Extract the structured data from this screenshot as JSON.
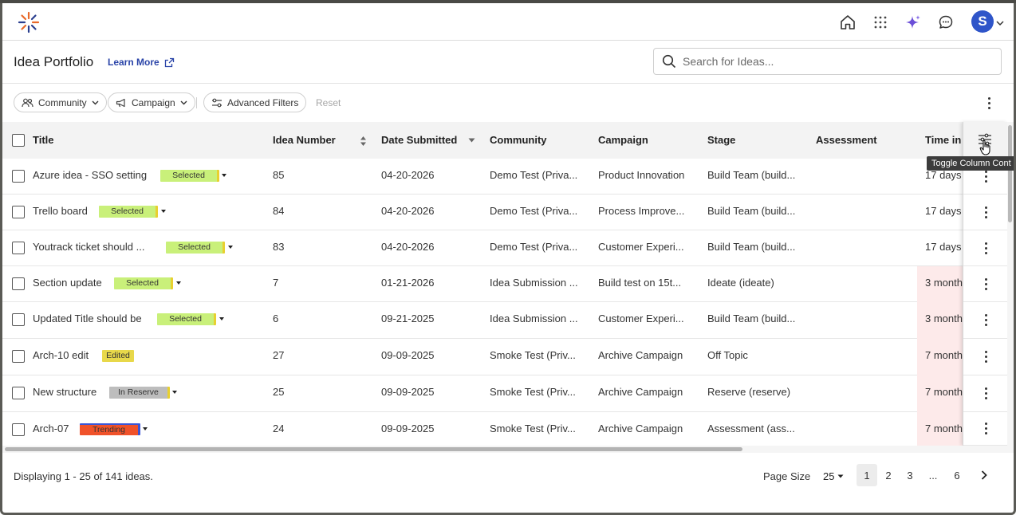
{
  "header": {
    "icons": [
      "home-icon",
      "apps-grid-icon",
      "ai-sparkle-icon",
      "chat-icon"
    ],
    "avatar_initial": "S"
  },
  "titlebar": {
    "title": "Idea Portfolio",
    "learn_more": "Learn More",
    "search_placeholder": "Search for Ideas..."
  },
  "filters": {
    "community": "Community",
    "campaign": "Campaign",
    "advanced": "Advanced Filters",
    "reset": "Reset"
  },
  "columns": {
    "title": "Title",
    "idea_number": "Idea Number",
    "date_submitted": "Date Submitted",
    "community": "Community",
    "campaign": "Campaign",
    "stage": "Stage",
    "assessment": "Assessment",
    "time_in": "Time in"
  },
  "tooltip": "Toggle Column Cont",
  "rows": [
    {
      "title": "Azure idea - SSO setting",
      "status": "Selected",
      "number": "85",
      "date": "04-20-2026",
      "community": "Demo Test (Priva...",
      "campaign": "Product Innovation",
      "stage": "Build Team (build...",
      "assessment": "",
      "time": "17 days"
    },
    {
      "title": "Trello board",
      "status": "Selected",
      "number": "84",
      "date": "04-20-2026",
      "community": "Demo Test (Priva...",
      "campaign": "Process Improve...",
      "stage": "Build Team (build...",
      "assessment": "",
      "time": "17 days"
    },
    {
      "title": "Youtrack ticket should ...",
      "status": "Selected",
      "number": "83",
      "date": "04-20-2026",
      "community": "Demo Test (Priva...",
      "campaign": "Customer Experi...",
      "stage": "Build Team (build...",
      "assessment": "",
      "time": "17 days"
    },
    {
      "title": "Section update",
      "status": "Selected",
      "number": "7",
      "date": "01-21-2026",
      "community": "Idea Submission ...",
      "campaign": "Build test on 15t...",
      "stage": "Ideate (ideate)",
      "assessment": "",
      "time": "3 month"
    },
    {
      "title": "Updated Title should be",
      "status": "Selected",
      "number": "6",
      "date": "09-21-2025",
      "community": "Idea Submission ...",
      "campaign": "Customer Experi...",
      "stage": "Build Team (build...",
      "assessment": "",
      "time": "3 month"
    },
    {
      "title": "Arch-10 edit",
      "status": "Edited",
      "number": "27",
      "date": "09-09-2025",
      "community": "Smoke Test (Priv...",
      "campaign": "Archive Campaign",
      "stage": "Off Topic",
      "assessment": "",
      "time": "7 month"
    },
    {
      "title": "New structure",
      "status": "In Reserve",
      "number": "25",
      "date": "09-09-2025",
      "community": "Smoke Test (Priv...",
      "campaign": "Archive Campaign",
      "stage": "Reserve (reserve)",
      "assessment": "",
      "time": "7 month"
    },
    {
      "title": "Arch-07",
      "status": "Trending",
      "number": "24",
      "date": "09-09-2025",
      "community": "Smoke Test (Priv...",
      "campaign": "Archive Campaign",
      "stage": "Assessment (ass...",
      "assessment": "",
      "time": "7 month"
    }
  ],
  "footer": {
    "display": "Displaying 1 - 25 of 141 ideas.",
    "page_size_label": "Page Size",
    "page_size": "25",
    "pages": [
      "1",
      "2",
      "3",
      "...",
      "6"
    ],
    "current_page": "1"
  },
  "colors": {
    "selected": "#c9f07a",
    "edited": "#e8d84a",
    "in_reserve": "#bdbdbd",
    "trending": "#f0522a",
    "time_highlight": "#fdeaea",
    "avatar": "#2f55c9",
    "link": "#2a44a8"
  }
}
